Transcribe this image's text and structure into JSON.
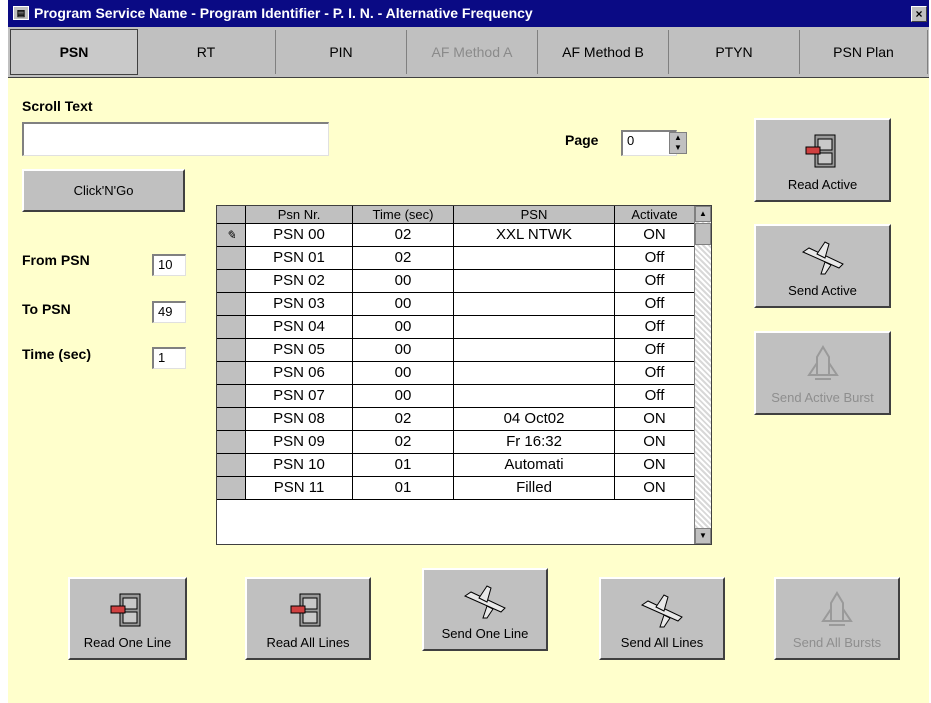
{
  "window": {
    "title": "Program Service Name - Program Identifier - P. I. N. - Alternative Frequency",
    "close_label": "×"
  },
  "tabs": [
    {
      "label": "PSN",
      "active": true
    },
    {
      "label": "RT"
    },
    {
      "label": "PIN"
    },
    {
      "label": "AF Method A",
      "disabled": true
    },
    {
      "label": "AF Method B"
    },
    {
      "label": "PTYN"
    },
    {
      "label": "PSN Plan"
    }
  ],
  "scroll": {
    "label": "Scroll Text",
    "value": ""
  },
  "page": {
    "label": "Page",
    "value": "0"
  },
  "buttons": {
    "click_n_go": "Click'N'Go",
    "read_active": "Read Active",
    "send_active": "Send Active",
    "send_active_burst": "Send Active Burst",
    "read_one_line": "Read One Line",
    "read_all_lines": "Read All Lines",
    "send_one_line": "Send One Line",
    "send_all_lines": "Send All Lines",
    "send_all_bursts": "Send All Bursts"
  },
  "fields": {
    "from_psn_label": "From PSN",
    "from_psn_value": "10",
    "to_psn_label": "To PSN",
    "to_psn_value": "49",
    "time_label": "Time (sec)",
    "time_value": "1"
  },
  "grid": {
    "headers": [
      "Psn Nr.",
      "Time (sec)",
      "PSN",
      "Activate"
    ],
    "edit_marker": "✎",
    "rows": [
      {
        "nr": "PSN 00",
        "time": "02",
        "psn": "XXL NTWK",
        "act": "ON"
      },
      {
        "nr": "PSN 01",
        "time": "02",
        "psn": "",
        "act": "Off"
      },
      {
        "nr": "PSN 02",
        "time": "00",
        "psn": "",
        "act": "Off"
      },
      {
        "nr": "PSN 03",
        "time": "00",
        "psn": "",
        "act": "Off"
      },
      {
        "nr": "PSN 04",
        "time": "00",
        "psn": "",
        "act": "Off"
      },
      {
        "nr": "PSN 05",
        "time": "00",
        "psn": "",
        "act": "Off"
      },
      {
        "nr": "PSN 06",
        "time": "00",
        "psn": "",
        "act": "Off"
      },
      {
        "nr": "PSN 07",
        "time": "00",
        "psn": "",
        "act": "Off"
      },
      {
        "nr": "PSN 08",
        "time": "02",
        "psn": "04 Oct02",
        "act": "ON"
      },
      {
        "nr": "PSN 09",
        "time": "02",
        "psn": "Fr 16:32",
        "act": "ON"
      },
      {
        "nr": "PSN 10",
        "time": "01",
        "psn": "Automati",
        "act": "ON"
      },
      {
        "nr": "PSN 11",
        "time": "01",
        "psn": "Filled",
        "act": "ON"
      }
    ]
  },
  "icons": {
    "file_cabinet": "file-cabinet-icon",
    "airplane": "airplane-icon",
    "shuttle": "shuttle-icon"
  }
}
